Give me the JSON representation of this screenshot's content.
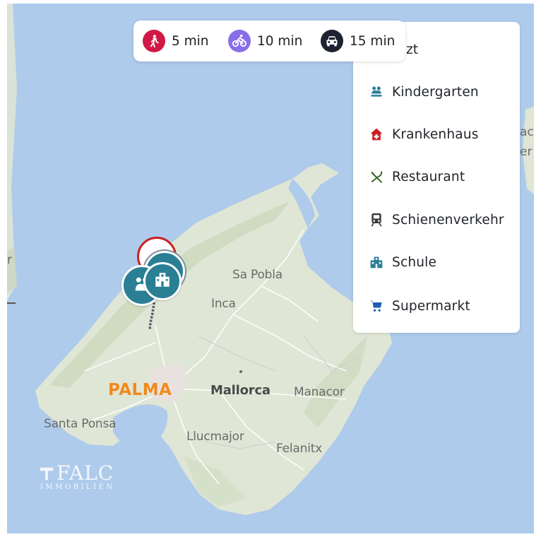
{
  "travel_modes": [
    {
      "name": "walk",
      "label": "5 min",
      "color": "#d01a45",
      "icon": "walking-person-icon"
    },
    {
      "name": "bike",
      "label": "10 min",
      "color": "#8a6de9",
      "icon": "bicycle-icon"
    },
    {
      "name": "car",
      "label": "15 min",
      "color": "#1e2230",
      "icon": "car-icon"
    }
  ],
  "poi_panel": {
    "partial_top_label": "zt",
    "items": [
      {
        "label": "Kindergarten",
        "icon": "kindergarten-icon",
        "color": "#2a7f95"
      },
      {
        "label": "Krankenhaus",
        "icon": "hospital-icon",
        "color": "#cc1f1f"
      },
      {
        "label": "Restaurant",
        "icon": "restaurant-icon",
        "color": "#3b6b2a"
      },
      {
        "label": "Schienenverkehr",
        "icon": "train-icon",
        "color": "#3a3a3a"
      },
      {
        "label": "Schule",
        "icon": "school-icon",
        "color": "#2a7f95"
      },
      {
        "label": "Supermarkt",
        "icon": "shopping-cart-icon",
        "color": "#1f5fb8"
      }
    ]
  },
  "map": {
    "places": {
      "sa_pobla": "Sa Pobla",
      "inca": "Inca",
      "palma": "PALMA",
      "mallorca": "Mallorca",
      "manacor": "Manacor",
      "santa_ponsa": "Santa Ponsa",
      "llucmajor": "Llucmajor",
      "felanitx": "Felanitx"
    },
    "right_edge_fragment_1": "ac",
    "right_edge_fragment_2": "er",
    "left_edge_fragment": "r",
    "colors": {
      "sea": "#aecbeb",
      "land": "#dfe6d5",
      "capital": "#f08a1c"
    }
  },
  "watermark": {
    "brand": "FALC",
    "sub": "IMMOBILIEN"
  }
}
